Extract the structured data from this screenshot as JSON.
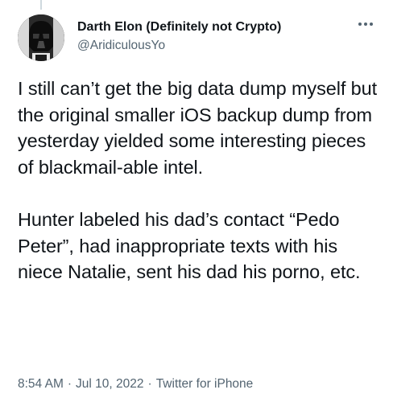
{
  "author": {
    "display_name": "Darth Elon (Definitely not Crypto)",
    "handle": "@AridiculousYo",
    "avatar_icon": "darth-vader-avatar"
  },
  "tweet": {
    "paragraphs": [
      "I still can’t get the big data dump myself but the original smaller iOS backup dump from yesterday yielded some interesting pieces of blackmail-able intel.",
      "Hunter labeled his dad’s contact “Pedo Peter”, had inappropriate texts with his niece Natalie, sent his dad his porno, etc."
    ]
  },
  "meta": {
    "time": "8:54 AM",
    "separator": "·",
    "date": "Jul 10, 2022",
    "source": "Twitter for iPhone"
  },
  "colors": {
    "text": "#0f1419",
    "secondary": "#536471",
    "thread_line": "#cfd9de"
  },
  "icons": {
    "more": "more-dots-icon"
  }
}
